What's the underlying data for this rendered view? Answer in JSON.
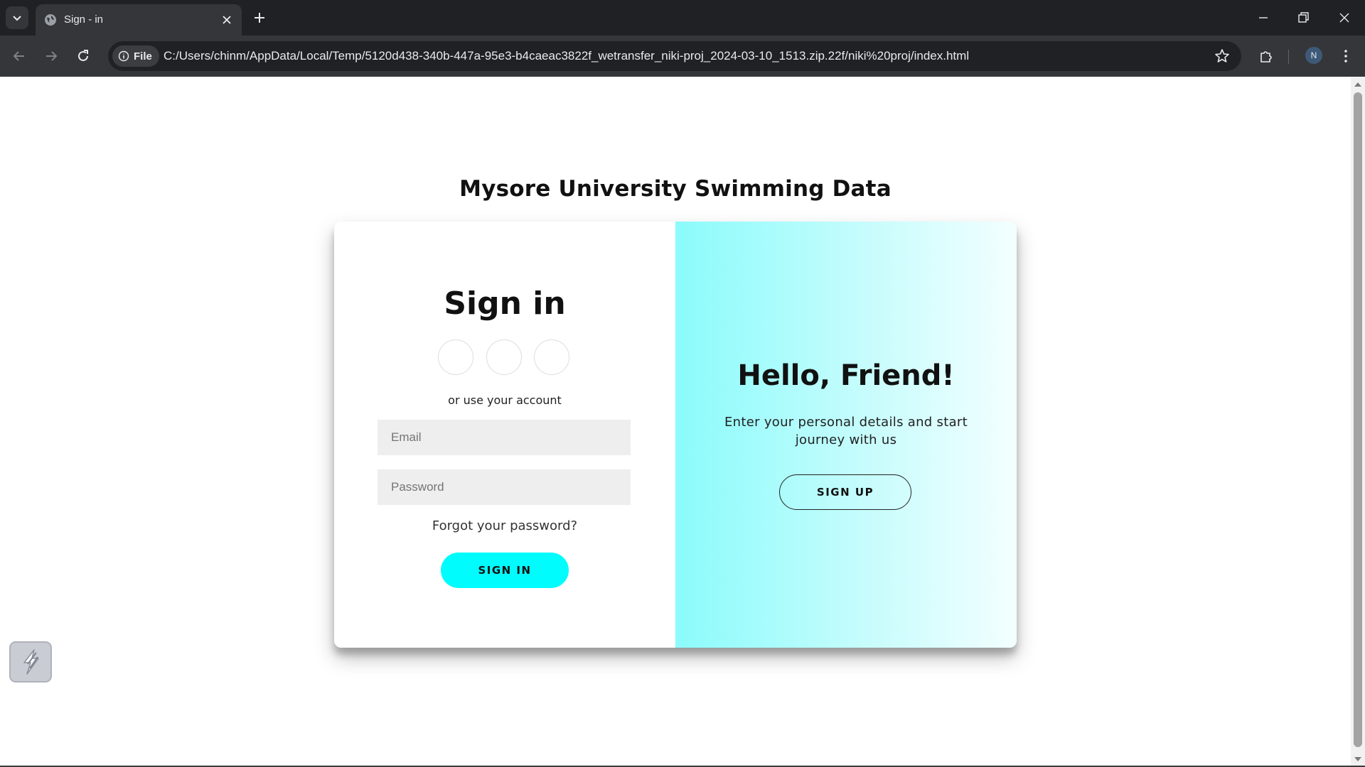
{
  "browser": {
    "tab_title": "Sign - in",
    "address_chip": "File",
    "url": "C:/Users/chinm/AppData/Local/Temp/5120d438-340b-447a-95e3-b4caeac3822f_wetransfer_niki-proj_2024-03-10_1513.zip.22f/niki%20proj/index.html",
    "profile_initial": "N"
  },
  "page": {
    "title": "Mysore University Swimming Data"
  },
  "signin": {
    "heading": "Sign in",
    "or_text": "or use your account",
    "email_placeholder": "Email",
    "password_placeholder": "Password",
    "forgot_link": "Forgot your password?",
    "button": "SIGN IN"
  },
  "overlay": {
    "heading": "Hello, Friend!",
    "text": "Enter your personal details and start journey with us",
    "button": "SIGN UP"
  },
  "colors": {
    "accent_cyan": "#00fcfc",
    "gradient_start": "#8bfbfb",
    "gradient_end": "#f3ffff",
    "chrome_dark": "#202124"
  }
}
